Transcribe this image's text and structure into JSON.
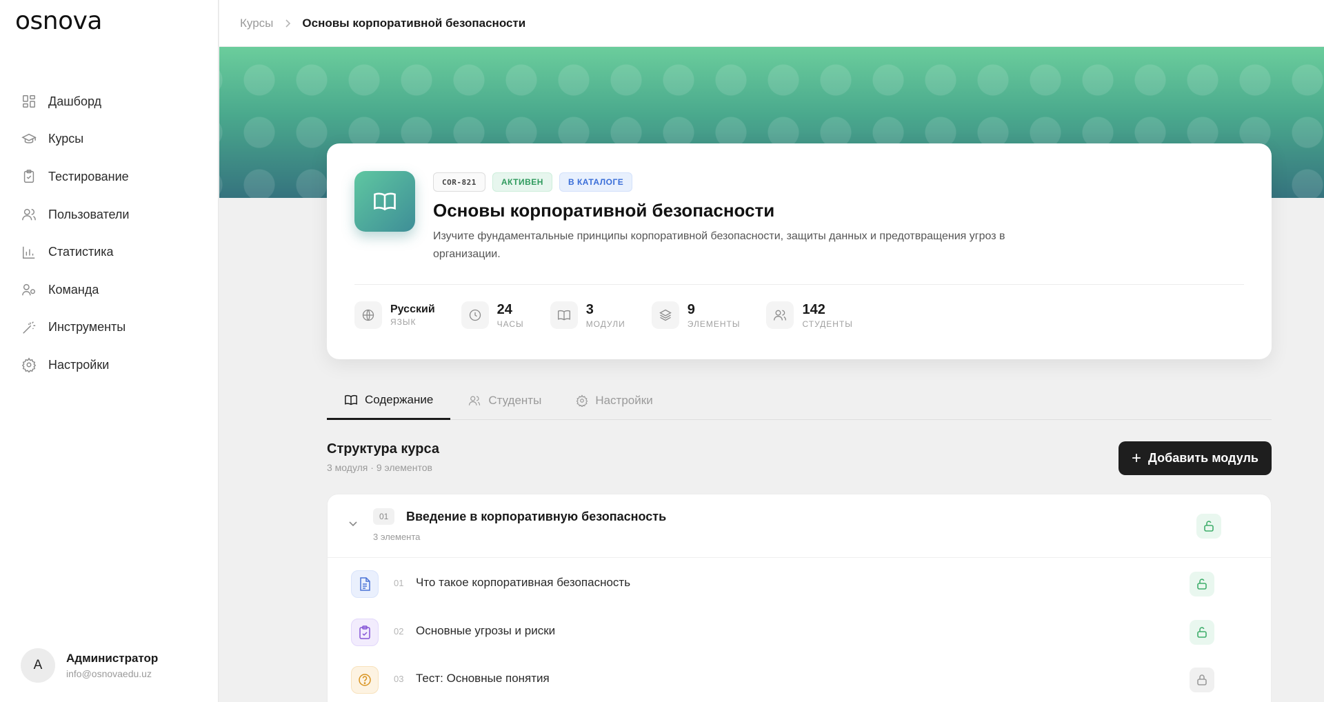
{
  "app": {
    "logo": "osnova"
  },
  "sidebar": {
    "items": [
      {
        "label": "Дашборд",
        "icon": "dashboard-icon"
      },
      {
        "label": "Курсы",
        "icon": "graduation-cap-icon"
      },
      {
        "label": "Тестирование",
        "icon": "clipboard-check-icon"
      },
      {
        "label": "Пользователи",
        "icon": "users-icon"
      },
      {
        "label": "Статистика",
        "icon": "bar-chart-icon"
      },
      {
        "label": "Команда",
        "icon": "team-icon"
      },
      {
        "label": "Инструменты",
        "icon": "magic-wand-icon"
      },
      {
        "label": "Настройки",
        "icon": "gear-icon"
      }
    ],
    "user": {
      "initial": "A",
      "name": "Администратор",
      "email": "info@osnovaedu.uz"
    }
  },
  "breadcrumb": {
    "parent": "Курсы",
    "current": "Основы корпоративной безопасности"
  },
  "course": {
    "code": "COR-821",
    "status_badge": "АКТИВЕН",
    "catalog_badge": "В КАТАЛОГЕ",
    "title": "Основы корпоративной безопасности",
    "description": "Изучите фундаментальные принципы корпоративной безопасности, защиты данных и предотвращения угроз в организации.",
    "stats": [
      {
        "value": "Русский",
        "label": "ЯЗЫК",
        "icon": "globe-icon"
      },
      {
        "value": "24",
        "label": "ЧАСЫ",
        "icon": "clock-icon"
      },
      {
        "value": "3",
        "label": "МОДУЛИ",
        "icon": "book-icon"
      },
      {
        "value": "9",
        "label": "ЭЛЕМЕНТЫ",
        "icon": "layers-icon"
      },
      {
        "value": "142",
        "label": "СТУДЕНТЫ",
        "icon": "users-icon"
      }
    ]
  },
  "tabs": [
    {
      "label": "Содержание",
      "icon": "book-icon",
      "active": true
    },
    {
      "label": "Студенты",
      "icon": "users-icon",
      "active": false
    },
    {
      "label": "Настройки",
      "icon": "gear-icon",
      "active": false
    }
  ],
  "structure": {
    "title": "Структура курса",
    "subtitle": "3 модуля · 9 элементов",
    "add_button": "Добавить модуль"
  },
  "module": {
    "number": "01",
    "title": "Введение в корпоративную безопасность",
    "count": "3 элемента",
    "items": [
      {
        "number": "01",
        "title": "Что такое корпоративная безопасность",
        "type": "document",
        "lock": "unlocked"
      },
      {
        "number": "02",
        "title": "Основные угрозы и риски",
        "type": "assignment",
        "lock": "unlocked"
      },
      {
        "number": "03",
        "title": "Тест: Основные понятия",
        "type": "quiz",
        "lock": "locked"
      }
    ]
  },
  "colors": {
    "accent_dark": "#1e1e1e",
    "active_green": "#2f9a5d",
    "catalog_blue": "#3a6ed8",
    "hero_top": "#6bcd9c",
    "hero_bottom": "#35737e"
  }
}
